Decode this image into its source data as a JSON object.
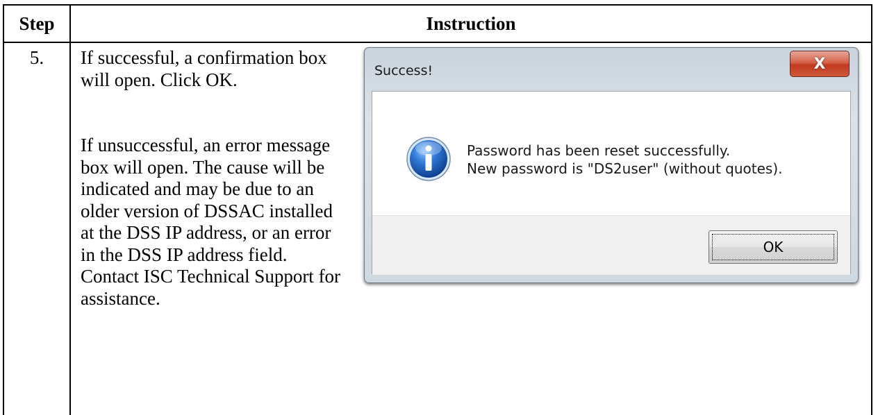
{
  "table": {
    "header_step": "Step",
    "header_instruction": "Instruction"
  },
  "row": {
    "step_number": "5.",
    "paragraph_success": "If successful, a confirmation box will open. Click OK.",
    "paragraph_failure": "If unsuccessful, an error message box will open. The cause will be indicated and may be due to an older version of DSSAC installed at the DSS IP address, or an error in the DSS IP address field.  Contact ISC Technical Support for assistance."
  },
  "dialog": {
    "title": "Success!",
    "close_label": "X",
    "message_line1": "Password has been reset successfully.",
    "message_line2": "New password is \"DS2user\" (without quotes).",
    "ok_label": "OK",
    "icon": "info-icon"
  },
  "colors": {
    "close_button": "#c23a20",
    "info_icon": "#1f5fb8"
  }
}
